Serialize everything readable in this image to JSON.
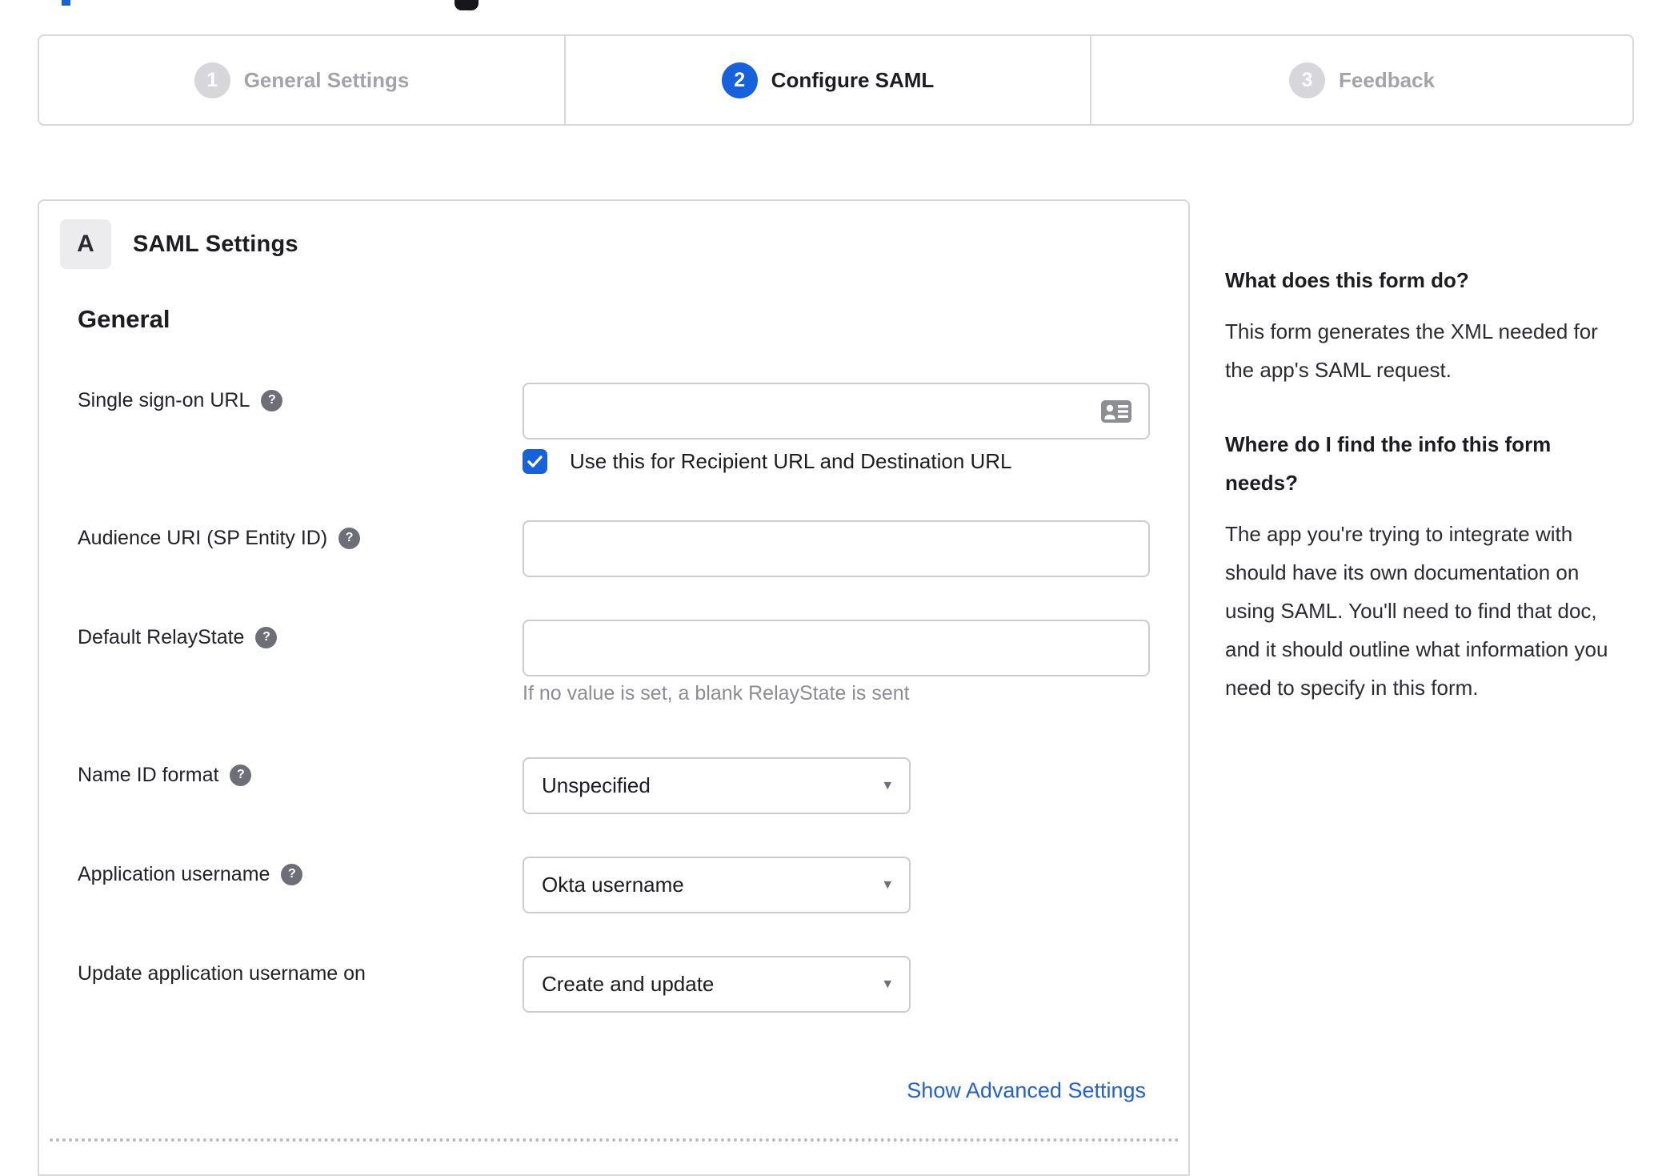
{
  "colors": {
    "accent_blue": "#1662dd",
    "link_blue": "#2160dd",
    "border_gray": "#d8d8dc",
    "inactive_gray": "#a3a3ac"
  },
  "stepper": {
    "steps": [
      {
        "number": "1",
        "label": "General Settings",
        "state": "inactive"
      },
      {
        "number": "2",
        "label": "Configure SAML",
        "state": "active"
      },
      {
        "number": "3",
        "label": "Feedback",
        "state": "inactive"
      }
    ]
  },
  "form": {
    "section_badge": "A",
    "section_title": "SAML Settings",
    "group_title": "General",
    "fields": {
      "sso_url": {
        "label": "Single sign-on URL",
        "value": "",
        "checkbox_label": "Use this for Recipient URL and Destination URL",
        "checkbox_checked": true
      },
      "audience_uri": {
        "label": "Audience URI (SP Entity ID)",
        "value": ""
      },
      "default_relaystate": {
        "label": "Default RelayState",
        "value": "",
        "hint": "If no value is set, a blank RelayState is sent"
      },
      "name_id_format": {
        "label": "Name ID format",
        "value": "Unspecified"
      },
      "application_username": {
        "label": "Application username",
        "value": "Okta username"
      },
      "update_app_username": {
        "label": "Update application username on",
        "value": "Create and update"
      }
    },
    "advanced_link": "Show Advanced Settings"
  },
  "help_panel": {
    "section1_title": "What does this form do?",
    "section1_body": "This form generates the XML needed for the app's SAML request.",
    "section2_title": "Where do I find the info this form needs?",
    "section2_body": "The app you're trying to integrate with should have its own documentation on using SAML. You'll need to find that doc, and it should outline what information you need to specify in this form."
  }
}
